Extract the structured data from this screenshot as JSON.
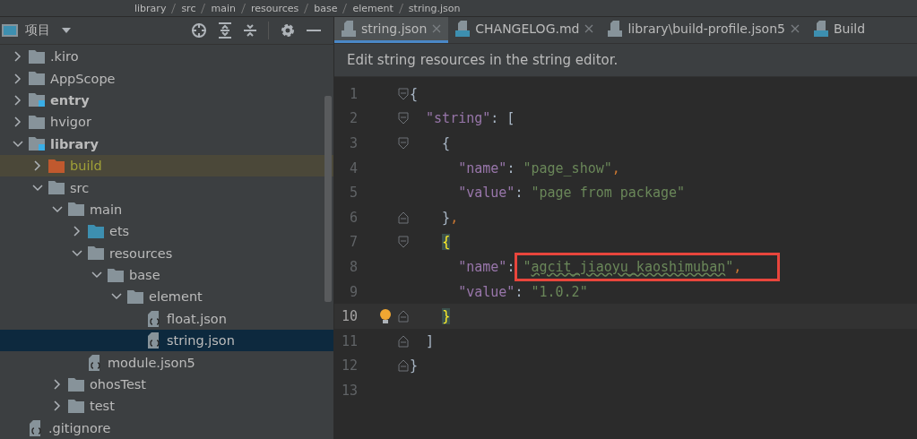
{
  "breadcrumb": [
    "library",
    "src",
    "main",
    "resources",
    "base",
    "element",
    "string.json"
  ],
  "project_panel": {
    "title": "项目",
    "tree": [
      {
        "name": ".kiro",
        "kind": "folder",
        "expanded": false,
        "selected": false
      },
      {
        "name": "AppScope",
        "kind": "folder",
        "expanded": false,
        "selected": false
      },
      {
        "name": "entry",
        "kind": "module",
        "expanded": false,
        "selected": false
      },
      {
        "name": "hvigor",
        "kind": "folder",
        "expanded": false,
        "selected": false
      },
      {
        "name": "library",
        "kind": "module",
        "expanded": true,
        "selected": false,
        "children": [
          {
            "name": "build",
            "kind": "excluded",
            "expanded": false,
            "selected": false
          },
          {
            "name": "src",
            "kind": "folder",
            "expanded": true,
            "selected": false,
            "children": [
              {
                "name": "main",
                "kind": "folder",
                "expanded": true,
                "selected": false,
                "children": [
                  {
                    "name": "ets",
                    "kind": "source",
                    "expanded": false,
                    "selected": false
                  },
                  {
                    "name": "resources",
                    "kind": "folder",
                    "expanded": true,
                    "selected": false,
                    "children": [
                      {
                        "name": "base",
                        "kind": "folder",
                        "expanded": true,
                        "selected": false,
                        "children": [
                          {
                            "name": "element",
                            "kind": "folder",
                            "expanded": true,
                            "selected": false,
                            "children": [
                              {
                                "name": "float.json",
                                "kind": "file",
                                "selected": false
                              },
                              {
                                "name": "string.json",
                                "kind": "file",
                                "selected": true
                              }
                            ]
                          }
                        ]
                      }
                    ]
                  },
                  {
                    "name": "module.json5",
                    "kind": "file",
                    "selected": false
                  }
                ]
              },
              {
                "name": "ohosTest",
                "kind": "folder",
                "expanded": false,
                "selected": false
              },
              {
                "name": "test",
                "kind": "folder",
                "expanded": false,
                "selected": false
              }
            ]
          }
        ]
      },
      {
        "name": ".gitignore",
        "kind": "file",
        "selected": false
      }
    ]
  },
  "tabs": [
    {
      "label": "string.json",
      "kind": "json",
      "selected": true,
      "closable": true
    },
    {
      "label": "CHANGELOG.md",
      "kind": "md",
      "selected": false,
      "closable": true
    },
    {
      "label": "library\\build-profile.json5",
      "kind": "json",
      "selected": false,
      "closable": true
    },
    {
      "label": "Build",
      "kind": "ets",
      "selected": false,
      "closable": false
    }
  ],
  "banner": "Edit string resources in the string editor.",
  "code_lines": [
    {
      "number": "1",
      "current": false,
      "kind": "fold-start",
      "tokens": [
        {
          "text": "{",
          "kind": "punct"
        }
      ]
    },
    {
      "number": "2",
      "current": false,
      "kind": "fold-start",
      "tokens": [
        {
          "text": "  \"string\"",
          "kind": "key"
        },
        {
          "text": ": [",
          "kind": "punct"
        }
      ]
    },
    {
      "number": "3",
      "current": false,
      "kind": "fold-start",
      "tokens": [
        {
          "text": "    {",
          "kind": "punct"
        }
      ]
    },
    {
      "number": "4",
      "current": false,
      "kind": "plain",
      "tokens": [
        {
          "text": "      \"name\"",
          "kind": "key"
        },
        {
          "text": ": ",
          "kind": "punct"
        },
        {
          "text": "\"page_show\"",
          "kind": "string"
        },
        {
          "text": ",",
          "kind": "comma"
        }
      ]
    },
    {
      "number": "5",
      "current": false,
      "kind": "plain",
      "tokens": [
        {
          "text": "      \"value\"",
          "kind": "key"
        },
        {
          "text": ": ",
          "kind": "punct"
        },
        {
          "text": "\"page from package\"",
          "kind": "string"
        }
      ]
    },
    {
      "number": "6",
      "current": false,
      "kind": "fold-end",
      "tokens": [
        {
          "text": "    }",
          "kind": "punct"
        },
        {
          "text": ",",
          "kind": "comma"
        }
      ]
    },
    {
      "number": "7",
      "current": false,
      "kind": "fold-start",
      "tokens": [
        {
          "text": "    {",
          "kind": "brace-match"
        }
      ]
    },
    {
      "number": "8",
      "current": false,
      "kind": "plain",
      "tokens": [
        {
          "text": "      \"name\"",
          "kind": "key"
        },
        {
          "text": ": ",
          "kind": "punct"
        },
        {
          "text": "\"",
          "kind": "string",
          "boxed": true
        },
        {
          "text": "agcit_jiaoyu_kaoshimuban",
          "kind": "squiggle",
          "boxed": true
        },
        {
          "text": "\"",
          "kind": "string",
          "boxed": true
        },
        {
          "text": ",",
          "kind": "comma",
          "boxed": true
        }
      ]
    },
    {
      "number": "9",
      "current": false,
      "kind": "plain",
      "tokens": [
        {
          "text": "      \"value\"",
          "kind": "key"
        },
        {
          "text": ": ",
          "kind": "punct"
        },
        {
          "text": "\"1.0.2\"",
          "kind": "string"
        }
      ]
    },
    {
      "number": "10",
      "current": true,
      "kind": "fold-end",
      "bulb": true,
      "tokens": [
        {
          "text": "    }",
          "kind": "brace-match"
        }
      ]
    },
    {
      "number": "11",
      "current": false,
      "kind": "fold-end",
      "tokens": [
        {
          "text": "  ]",
          "kind": "punct"
        }
      ]
    },
    {
      "number": "12",
      "current": false,
      "kind": "fold-end",
      "tokens": [
        {
          "text": "}",
          "kind": "punct"
        }
      ]
    },
    {
      "number": "13",
      "current": false,
      "kind": "plain"
    }
  ]
}
